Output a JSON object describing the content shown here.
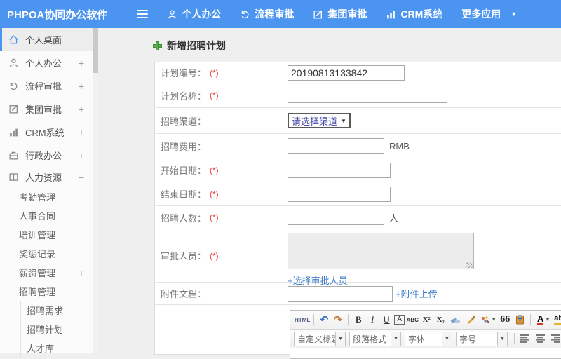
{
  "app": {
    "brand": "PHPOA协同办公软件"
  },
  "icons": {
    "caret_down": "▼",
    "select_caret": "▼",
    "dd_caret": "▼",
    "undo": "↶",
    "redo": "↷"
  },
  "topnav": {
    "items": [
      {
        "label": "个人办公"
      },
      {
        "label": "流程审批"
      },
      {
        "label": "集团审批"
      },
      {
        "label": "CRM系统"
      },
      {
        "label": "更多应用"
      }
    ]
  },
  "sidebar": {
    "items": [
      {
        "label": "个人桌面",
        "expand": ""
      },
      {
        "label": "个人办公",
        "expand": "+"
      },
      {
        "label": "流程审批",
        "expand": "+"
      },
      {
        "label": "集团审批",
        "expand": "+"
      },
      {
        "label": "CRM系统",
        "expand": "+"
      },
      {
        "label": "行政办公",
        "expand": "+"
      },
      {
        "label": "人力资源",
        "expand": "−"
      }
    ],
    "hr_children": [
      {
        "label": "考勤管理",
        "expand": ""
      },
      {
        "label": "人事合同",
        "expand": ""
      },
      {
        "label": "培训管理",
        "expand": ""
      },
      {
        "label": "奖惩记录",
        "expand": ""
      },
      {
        "label": "薪资管理",
        "expand": "+"
      },
      {
        "label": "招聘管理",
        "expand": "−"
      }
    ],
    "recruit_children": [
      {
        "label": "招聘需求"
      },
      {
        "label": "招聘计划"
      },
      {
        "label": "人才库"
      }
    ]
  },
  "page": {
    "title": "新增招聘计划"
  },
  "form": {
    "required_mark": "(*)",
    "rows": [
      {
        "label": "计划编号：",
        "value": "20190813133842"
      },
      {
        "label": "计划名称：",
        "value": ""
      },
      {
        "label": "招聘渠道：",
        "select_value": "请选择渠道"
      },
      {
        "label": "招聘费用：",
        "suffix": "RMB"
      },
      {
        "label": "开始日期：",
        "value": ""
      },
      {
        "label": "结束日期：",
        "value": ""
      },
      {
        "label": "招聘人数：",
        "suffix": "人"
      },
      {
        "label": "审批人员：",
        "link": "+选择审批人员"
      },
      {
        "label": "附件文档：",
        "link": "+附件上传"
      }
    ]
  },
  "editor": {
    "html_btn": "HTML",
    "bold": "B",
    "italic": "I",
    "underline": "U",
    "autotypeset": "A",
    "strike": "ABC",
    "superscript": "X²",
    "subscript": "X₂",
    "blockquote": "66",
    "fontcolor": "A",
    "highlight": "ab",
    "dropdowns": [
      {
        "label": "自定义标题"
      },
      {
        "label": "段落格式"
      },
      {
        "label": "字体"
      },
      {
        "label": "字号"
      }
    ]
  }
}
